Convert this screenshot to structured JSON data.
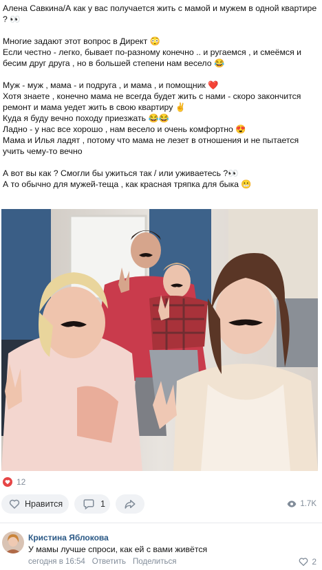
{
  "post": {
    "paragraphs": [
      [
        "Алена Савкина/А как у вас получается жить с мамой и мужем в одной квартире ? 👀"
      ],
      [
        "Многие задают этот вопрос в Директ 😳",
        "Если честно - легко, бывает по-разному конечно .. и ругаемся , и смеёмся и бесим друг друга , но в большей степени нам весело 😂"
      ],
      [
        "Муж - муж , мама - и подруга , и мама , и помощник ❤️",
        "Хотя знаете , конечно мама не всегда будет жить с нами - скоро закончится ремонт и мама уедет жить в свою квартиру ✌️",
        "Куда я буду вечно походу приезжать 😂😂",
        "Ладно - у нас все хорошо , нам весело и очень комфортно 😍",
        "Мама и Илья ладят , потому что мама не лезет в отношения и не пытается учить чему-то вечно"
      ],
      [
        "А вот вы как ? Смогли бы ужиться так / или уживаетесь ?👀",
        "А то обычно для мужей-теща , как красная тряпка для быка 😬"
      ]
    ]
  },
  "reactions": {
    "likes": "12",
    "like_label": "Нравится",
    "comments": "1",
    "views": "1.7K"
  },
  "icons": {
    "heart": "heart-icon",
    "comment": "comment-icon",
    "share": "share-icon",
    "views": "eye-icon"
  },
  "colors": {
    "heart": "#e64646",
    "link": "#2a5885",
    "muted": "#818c99",
    "button_bg": "#f0f2f5"
  },
  "comment": {
    "author": "Кристина Яблокова",
    "text": "У мамы лучше спроси, как ей с вами живётся",
    "time": "сегодня в 16:54",
    "reply": "Ответить",
    "share": "Поделиться",
    "likes": "2"
  }
}
